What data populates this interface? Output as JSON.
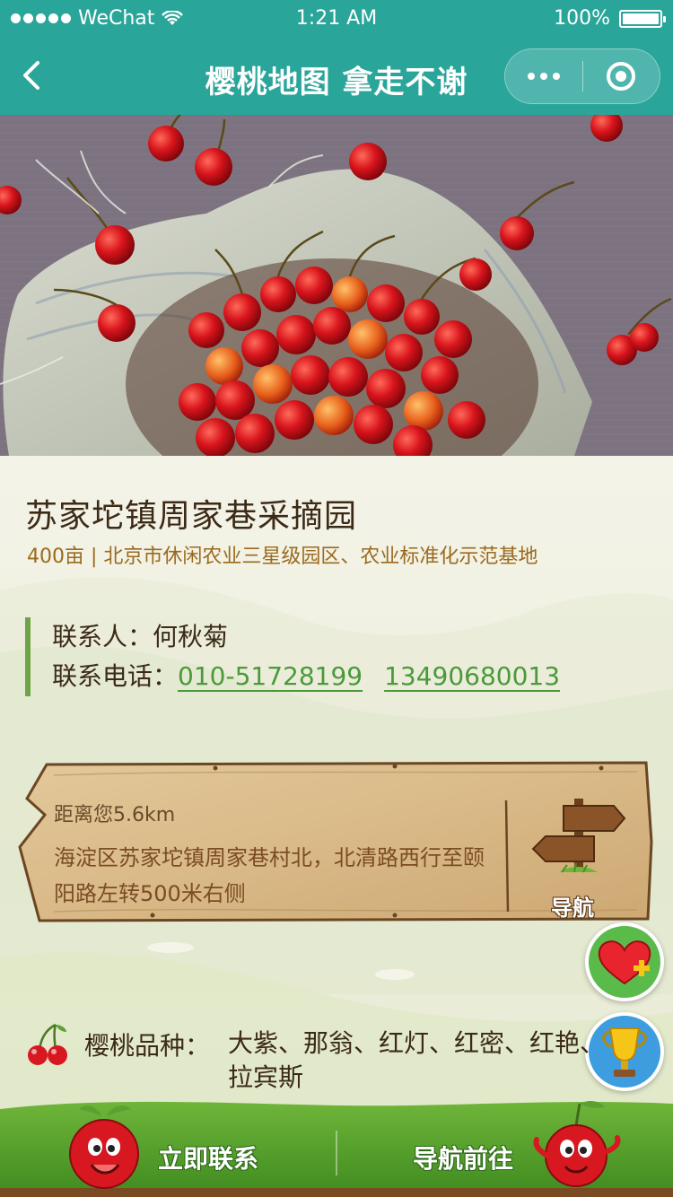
{
  "status_bar": {
    "carrier": "WeChat",
    "time": "1:21 AM",
    "battery": "100%",
    "battery_level": 1.0
  },
  "nav": {
    "title": "樱桃地图 拿走不谢"
  },
  "farm": {
    "name": "苏家坨镇周家巷采摘园",
    "meta": "400亩 | 北京市休闲农业三星级园区、农业标准化示范基地",
    "contact_label": "联系人：",
    "contact_name": "何秋菊",
    "phone_label": "联系电话：",
    "phones": [
      "010-51728199",
      "13490680013"
    ]
  },
  "location": {
    "distance": "距离您5.6km",
    "address": "海淀区苏家坨镇周家巷村北，北清路西行至颐阳路左转500米右侧",
    "nav_label": "导航"
  },
  "variety": {
    "label": "樱桃品种：",
    "value": "大紫、那翁、红灯、红密、红艳、拉宾斯"
  },
  "bottom": {
    "contact_label": "立即联系",
    "navigate_label": "导航前往"
  },
  "colors": {
    "header": "#2aa59a",
    "accent_green": "#6fa446",
    "link_green": "#4a9a3a",
    "meta_brown": "#9b6a1e"
  },
  "icons": [
    "back-icon",
    "more-icon",
    "close-capsule-icon",
    "signpost-icon",
    "heart-plus-icon",
    "trophy-icon",
    "cherry-icon",
    "apple-mascot-icon",
    "cherry-mascot-icon"
  ]
}
